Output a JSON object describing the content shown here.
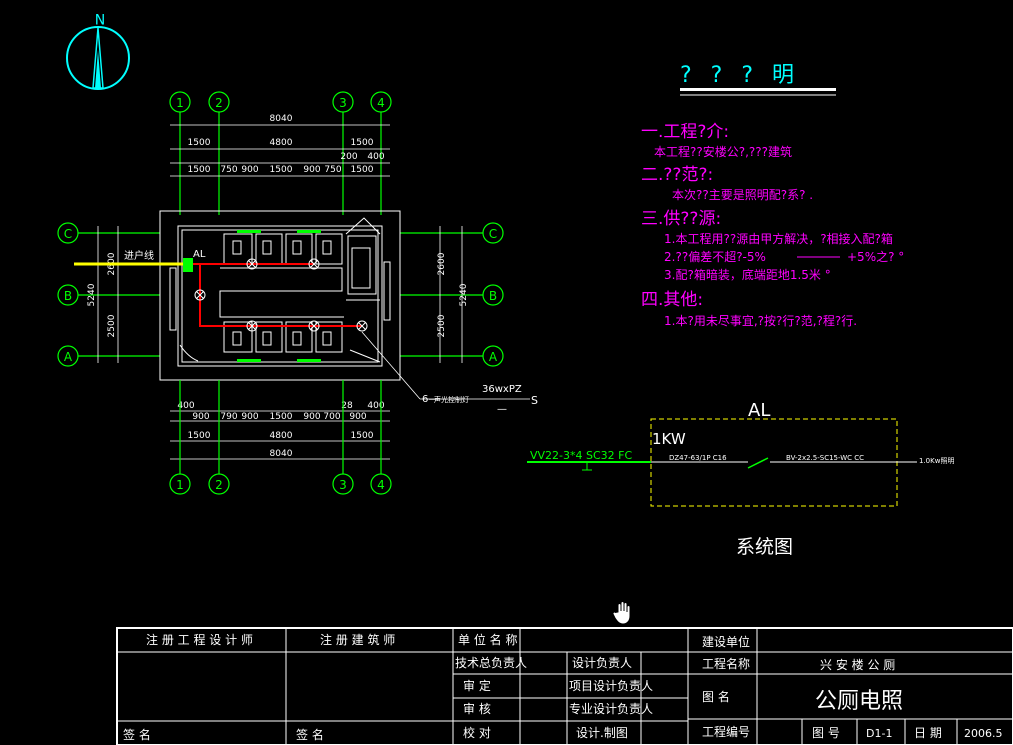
{
  "north_arrow": {
    "label": "N"
  },
  "dimensions": {
    "axis_cols": [
      "1",
      "2",
      "3",
      "4"
    ],
    "axis_rows": [
      "C",
      "B",
      "A"
    ],
    "top_total": "8040",
    "top_row2": [
      "1500",
      "4800",
      "1500"
    ],
    "top_extra": [
      "200",
      "400"
    ],
    "top_row3": [
      "1500",
      "750",
      "900",
      "1500",
      "900",
      "750",
      "1500"
    ],
    "bot_row1": [
      "400",
      "900",
      "790",
      "900",
      "1500",
      "900",
      "700",
      "900",
      "400"
    ],
    "bot_extra": "28",
    "bot_row2": [
      "1500",
      "4800",
      "1500"
    ],
    "bot_total": "8040",
    "left_vals": [
      "2600",
      "2500"
    ],
    "left_total": "5240",
    "right_vals": [
      "2600",
      "2500"
    ],
    "right_total": "5240"
  },
  "plan": {
    "incoming_label": "进户线",
    "panel_label": "AL",
    "callout_prefix": "6—",
    "callout_desc": "声光控制灯",
    "callout_spec": "36wxPZ",
    "callout_dash": "—",
    "callout_suffix": "S"
  },
  "notes": {
    "heading": "? ? ? 明",
    "sections": [
      {
        "title": "一.工程?介:",
        "lines": [
          "本工程??安楼公?,???建筑"
        ]
      },
      {
        "title": "二.??范?:",
        "lines": [
          "本次??主要是照明配?系? ."
        ]
      },
      {
        "title": "三.供??源:",
        "lines": [
          "1.本工程用??源由甲方解决，?相接入配?箱",
          "2.??偏差不超?-5%",
          "3.配?箱暗装，底端距地1.5米 °"
        ]
      },
      {
        "title": "四.其他:",
        "lines": [
          "1.本?用未尽事宜,?按?行?范,?程?行."
        ]
      }
    ],
    "tol_plus": "+5%之? °"
  },
  "system": {
    "box_label": "AL",
    "power": "1KW",
    "cable": "VV22-3*4 SC32 FC",
    "breaker": "DZ47-63/1P C16",
    "circuit": "BV-2x2.5-SC15-WC CC",
    "load": "1.0Kw照明",
    "title": "系统图"
  },
  "title_block": {
    "reg_engineer": "注 册 工 程 设 计 师",
    "reg_architect": "注  册  建  筑  师",
    "unit_name": "单 位 名 称",
    "tech_lead": "技术总负责人",
    "design_lead": "设计负责人",
    "build_unit": "建设单位",
    "project_name_label": "工程名称",
    "project_name": "兴 安 楼 公 厕",
    "review": "审      定",
    "project_lead": "项目设计负责人",
    "drawing_name_label": "图    名",
    "drawing_name": "公厕电照",
    "audit": "审      核",
    "discipline_lead": "专业设计负责人",
    "sign1": "签 名",
    "sign2": "签 名",
    "check": "校      对",
    "design_draw": "设计.制图",
    "project_no": "工程编号",
    "drawing_no_label": "图      号",
    "drawing_no": "D1-1",
    "date_label": "日      期",
    "date": "2006.5"
  },
  "colors": {
    "background": "#000000",
    "line": "#ffffff",
    "axis": "#00ff00",
    "note": "#ff00ff",
    "accent_cyan": "#00ffff",
    "circuit": "#ff0000",
    "feeder": "#ffff00"
  }
}
